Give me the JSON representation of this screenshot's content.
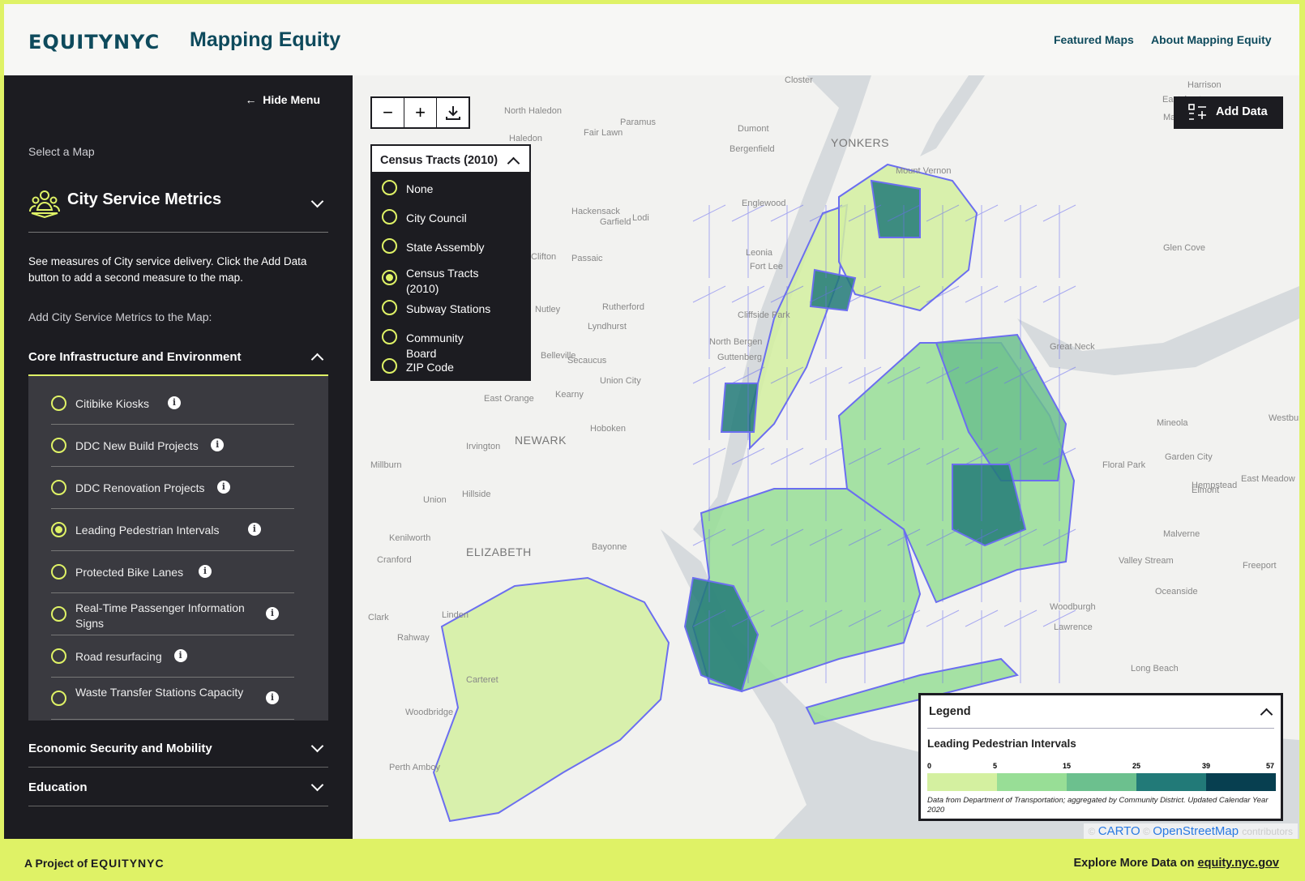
{
  "header": {
    "logo": "EQUITYNYC",
    "title": "Mapping Equity",
    "nav": [
      "Featured Maps",
      "About Mapping Equity"
    ]
  },
  "sidebar": {
    "hide_menu": "Hide Menu",
    "select_label": "Select a Map",
    "selected_map": "City Service Metrics",
    "description": "See measures of City service delivery. Click the Add Data button to add a second measure to the map.",
    "add_label": "Add City Service Metrics to the Map:",
    "sections": [
      {
        "label": "Core Infrastructure and Environment",
        "expanded": true,
        "items": [
          {
            "label": "Citibike Kiosks",
            "selected": false
          },
          {
            "label": "DDC New Build Projects",
            "selected": false
          },
          {
            "label": "DDC Renovation Projects",
            "selected": false
          },
          {
            "label": "Leading Pedestrian Intervals",
            "selected": true
          },
          {
            "label": "Protected Bike Lanes",
            "selected": false
          },
          {
            "label": "Real-Time Passenger Information Signs",
            "selected": false
          },
          {
            "label": "Road resurfacing",
            "selected": false
          },
          {
            "label": "Waste Transfer Stations Capacity",
            "selected": false
          }
        ]
      },
      {
        "label": "Economic Security and Mobility",
        "expanded": false
      },
      {
        "label": "Education",
        "expanded": false
      }
    ]
  },
  "map": {
    "controls": {
      "zoom_out": "−",
      "zoom_in": "+",
      "download": "download-icon"
    },
    "geography": {
      "selected": "Census Tracts (2010)",
      "options": [
        {
          "label": "None",
          "selected": false
        },
        {
          "label": "City Council",
          "selected": false
        },
        {
          "label": "State Assembly",
          "selected": false
        },
        {
          "label": "Census Tracts (2010)",
          "selected": true
        },
        {
          "label": "Subway Stations",
          "selected": false
        },
        {
          "label": "Community Board",
          "selected": false
        },
        {
          "label": "ZIP Code",
          "selected": false
        }
      ]
    },
    "add_data": "Add Data",
    "labels": [
      "YONKERS",
      "NEWARK",
      "ELIZABETH",
      "Mount Vernon",
      "Hackensack",
      "Englewood",
      "Fort Lee",
      "Paramus",
      "Passaic",
      "Clifton",
      "Nutley",
      "Belleville",
      "Kearny",
      "Hoboken",
      "Union City",
      "Secaucus",
      "Bayonne",
      "Linden",
      "Rahway",
      "Carteret",
      "Woodbridge",
      "Perth Amboy",
      "Union",
      "Irvington",
      "Hillside",
      "Cranford",
      "Harrison",
      "Eastchester",
      "Mamaroneck",
      "Dumont",
      "Bergenfield",
      "Fair Lawn",
      "Garfield",
      "Lodi",
      "Rutherford",
      "Lyndhurst",
      "North Bergen",
      "Guttenberg",
      "Cliffside Park",
      "Great Neck",
      "Glen Cove",
      "Mineola",
      "Garden City",
      "Hempstead",
      "Elmont",
      "Floral Park",
      "Valley Stream",
      "Oceanside",
      "Long Beach",
      "Freeport",
      "Westbury",
      "Malverne",
      "Woodburgh",
      "Lawrence",
      "East Orange",
      "Millburn",
      "Kenilworth",
      "Clark",
      "Closter",
      "Haledon",
      "North Haledon",
      "Leonia",
      "East Meadow"
    ],
    "attribution": [
      "CARTO",
      "OpenStreetMap",
      "contributors"
    ],
    "choropleth_colors": [
      "#d4f0a0",
      "#98de96",
      "#6cc08e",
      "#227a78",
      "#073f50"
    ],
    "boundary_color": "#6b6ef0"
  },
  "legend": {
    "title": "Legend",
    "layer": "Leading Pedestrian Intervals",
    "breaks": [
      "0",
      "5",
      "15",
      "25",
      "39",
      "57"
    ],
    "colors": [
      "#d4f0a0",
      "#98de96",
      "#6cc08e",
      "#227a78",
      "#073f50"
    ],
    "source": "Data from Department of Transportation; aggregated by Community District. Updated Calendar Year 2020"
  },
  "footer": {
    "left": "A Project of",
    "left_logo": "EQUITYNYC",
    "right": "Explore More Data on",
    "link": "equity.nyc.gov"
  },
  "colors": {
    "accent": "#dff266",
    "brand": "#0e4a5c",
    "sidebar": "#1c1c21"
  }
}
